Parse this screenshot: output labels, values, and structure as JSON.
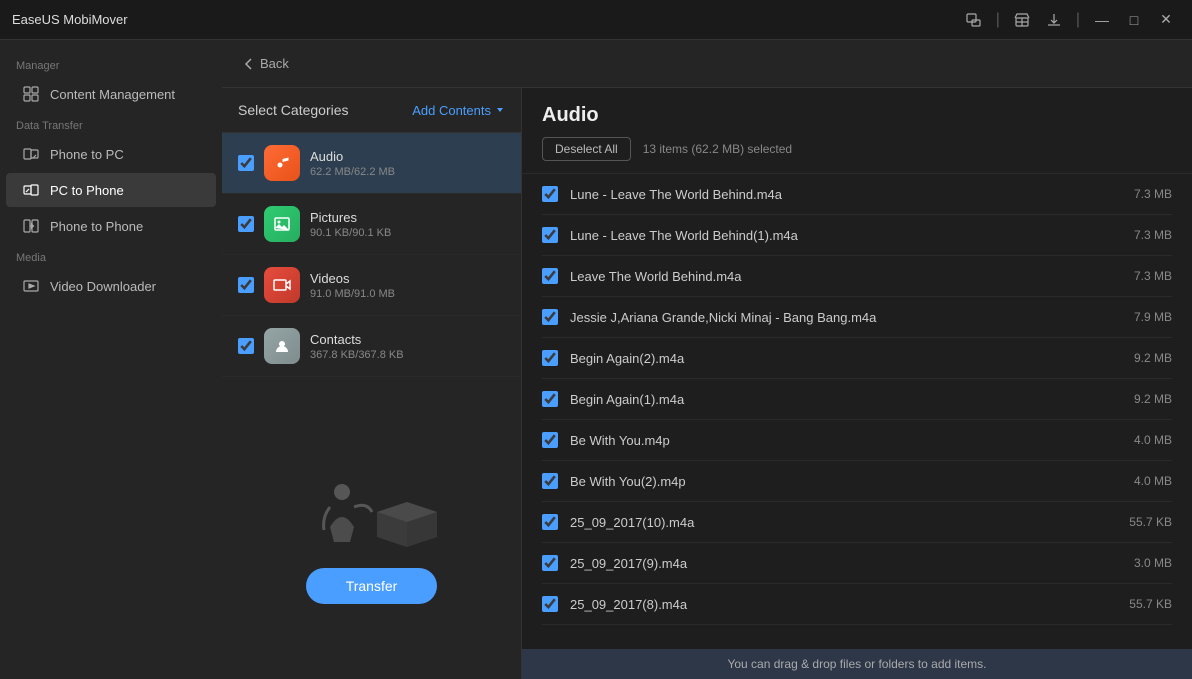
{
  "app": {
    "title": "EaseUS MobiMover"
  },
  "titlebar": {
    "back_label": "Back",
    "controls": {
      "devices": "⊞",
      "cart": "🛒",
      "download": "⬇",
      "minimize": "—",
      "maximize": "□",
      "close": "✕"
    }
  },
  "sidebar": {
    "manager_label": "Manager",
    "content_management_label": "Content Management",
    "data_transfer_label": "Data Transfer",
    "phone_to_pc_label": "Phone to PC",
    "pc_to_phone_label": "PC to Phone",
    "phone_to_phone_label": "Phone to Phone",
    "media_label": "Media",
    "video_downloader_label": "Video Downloader"
  },
  "categories": {
    "title": "Select Categories",
    "add_contents_label": "Add Contents",
    "items": [
      {
        "id": "audio",
        "name": "Audio",
        "size": "62.2 MB/62.2 MB",
        "checked": true
      },
      {
        "id": "pictures",
        "name": "Pictures",
        "size": "90.1 KB/90.1 KB",
        "checked": true
      },
      {
        "id": "videos",
        "name": "Videos",
        "size": "91.0 MB/91.0 MB",
        "checked": true
      },
      {
        "id": "contacts",
        "name": "Contacts",
        "size": "367.8 KB/367.8 KB",
        "checked": true
      }
    ]
  },
  "transfer_btn": "Transfer",
  "files": {
    "title": "Audio",
    "deselect_all_label": "Deselect All",
    "selection_info": "13 items (62.2 MB) selected",
    "items": [
      {
        "name": "Lune - Leave The World Behind.m4a",
        "size": "7.3 MB",
        "checked": true
      },
      {
        "name": "Lune - Leave The World Behind(1).m4a",
        "size": "7.3 MB",
        "checked": true
      },
      {
        "name": "Leave The World Behind.m4a",
        "size": "7.3 MB",
        "checked": true
      },
      {
        "name": "Jessie J,Ariana Grande,Nicki Minaj - Bang Bang.m4a",
        "size": "7.9 MB",
        "checked": true
      },
      {
        "name": "Begin Again(2).m4a",
        "size": "9.2 MB",
        "checked": true
      },
      {
        "name": "Begin Again(1).m4a",
        "size": "9.2 MB",
        "checked": true
      },
      {
        "name": "Be With You.m4p",
        "size": "4.0 MB",
        "checked": true
      },
      {
        "name": "Be With You(2).m4p",
        "size": "4.0 MB",
        "checked": true
      },
      {
        "name": "25_09_2017(10).m4a",
        "size": "55.7 KB",
        "checked": true
      },
      {
        "name": "25_09_2017(9).m4a",
        "size": "3.0 MB",
        "checked": true
      },
      {
        "name": "25_09_2017(8).m4a",
        "size": "55.7 KB",
        "checked": true
      }
    ]
  },
  "bottom_hint": "You can drag & drop files or folders to add items."
}
